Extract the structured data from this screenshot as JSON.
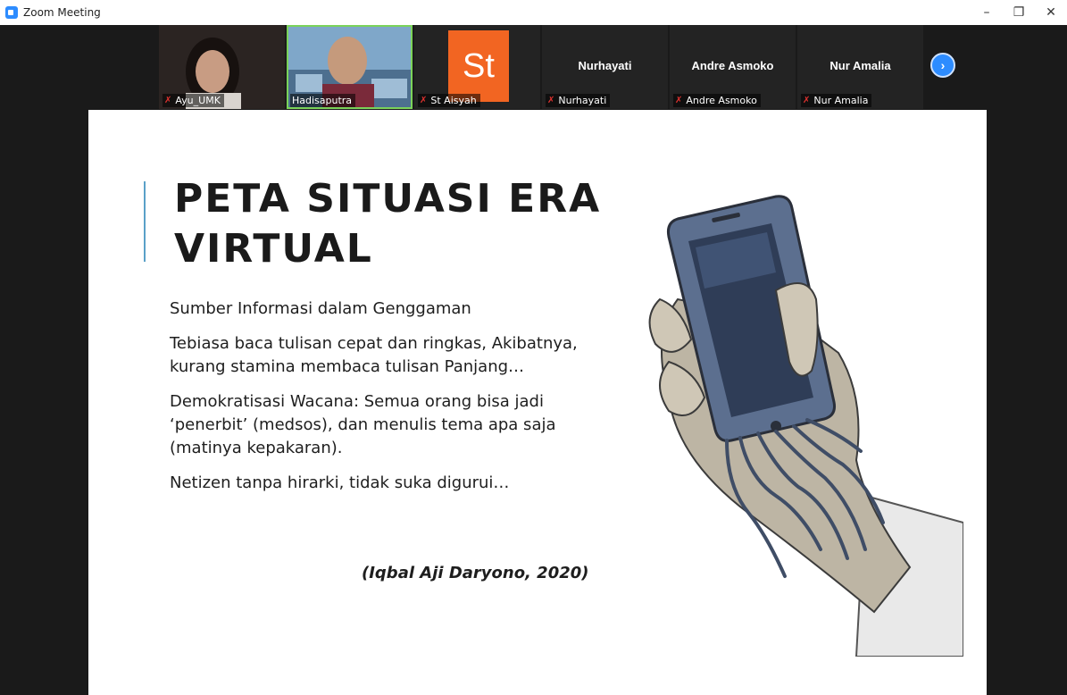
{
  "window": {
    "title": "Zoom Meeting",
    "minimize": "–",
    "restore": "❐",
    "close": "✕"
  },
  "participants": [
    {
      "display_name": "",
      "label": "Ayu_UMK",
      "muted": true,
      "video": true
    },
    {
      "display_name": "",
      "label": "Hadisaputra",
      "muted": false,
      "video": true,
      "active_speaker": true
    },
    {
      "display_name": "",
      "label": "St Aisyah",
      "muted": true,
      "avatar_text": "St",
      "avatar_color": "#f26522"
    },
    {
      "display_name": "Nurhayati",
      "label": "Nurhayati",
      "muted": true
    },
    {
      "display_name": "Andre Asmoko",
      "label": "Andre Asmoko",
      "muted": true
    },
    {
      "display_name": "Nur Amalia",
      "label": "Nur Amalia",
      "muted": true
    }
  ],
  "next_page_icon": "chevron-right-icon",
  "slide": {
    "title_line1": "PETA SITUASI ERA",
    "title_line2": "VIRTUAL",
    "points": [
      "Sumber Informasi dalam Genggaman",
      "Tebiasa baca tulisan cepat dan ringkas, Akibatnya, kurang stamina membaca tulisan Panjang…",
      "Demokratisasi Wacana: Semua orang bisa jadi ‘penerbit’ (medsos), dan menulis tema apa saja (matinya kepakaran).",
      "Netizen tanpa hirarki, tidak suka digurui…"
    ],
    "citation": "(Iqbal Aji Daryono, 2020)"
  },
  "colors": {
    "accent_bar": "#5aa1c8",
    "zoom_blue": "#2d8cff",
    "active_speaker_border": "#7bd35a",
    "muted_icon": "#e0322f"
  }
}
